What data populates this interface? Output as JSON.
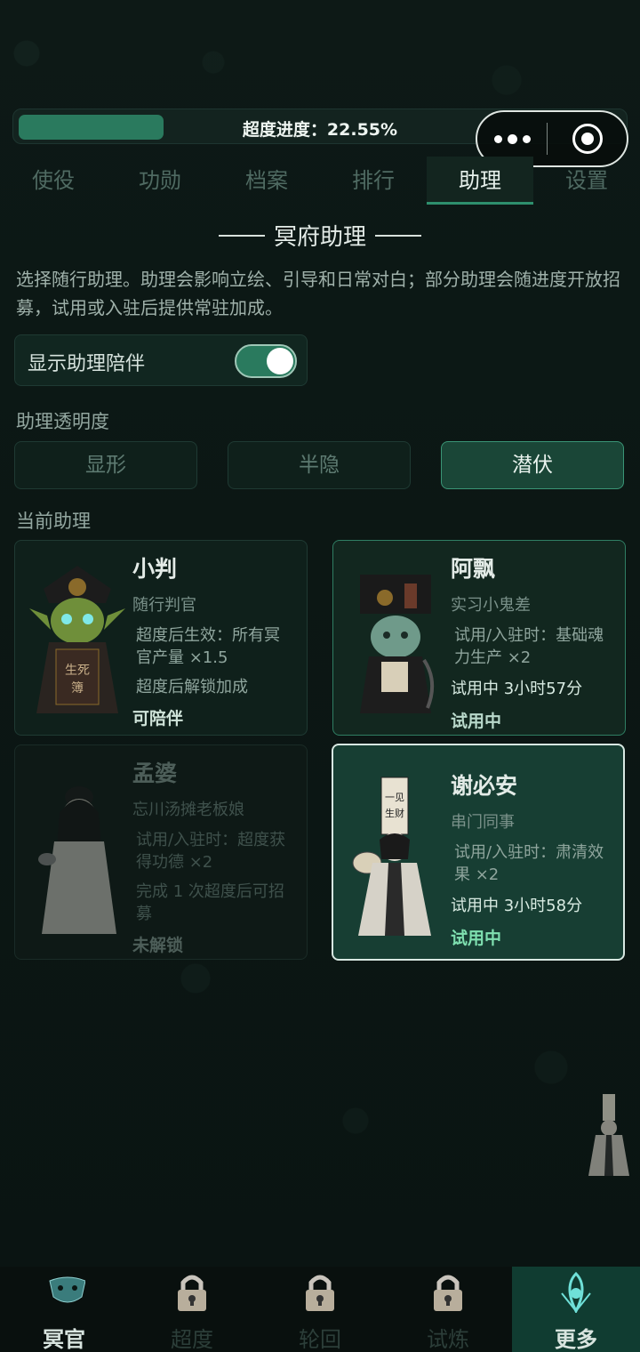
{
  "progress": {
    "label": "超度进度：22.55%",
    "fraction": 0.2255
  },
  "capsule": {
    "more_icon": "dots-icon",
    "close_icon": "target-icon"
  },
  "tabs": [
    {
      "label": "使役",
      "active": false
    },
    {
      "label": "功勋",
      "active": false
    },
    {
      "label": "档案",
      "active": false
    },
    {
      "label": "排行",
      "active": false
    },
    {
      "label": "助理",
      "active": true
    },
    {
      "label": "设置",
      "active": false
    }
  ],
  "section": {
    "title": "冥府助理",
    "description": "选择随行助理。助理会影响立绘、引导和日常对白；部分助理会随进度开放招募，试用或入驻后提供常驻加成。"
  },
  "toggle": {
    "label": "显示助理陪伴",
    "on": true
  },
  "opacity": {
    "label": "助理透明度",
    "options": [
      "显形",
      "半隐",
      "潜伏"
    ],
    "selected": "潜伏"
  },
  "current": {
    "label": "当前助理",
    "cards": [
      {
        "name": "小判",
        "role": "随行判官",
        "effect": "超度后生效：所有冥官产量 ×1.5",
        "status_line": "超度后解锁加成",
        "status": "可陪伴"
      },
      {
        "name": "阿飘",
        "role": "实习小鬼差",
        "effect": "试用/入驻时：基础魂力生产 ×2",
        "status_line": "试用中 3小时57分",
        "status": "试用中"
      },
      {
        "name": "孟婆",
        "role": "忘川汤摊老板娘",
        "effect": "试用/入驻时：超度获得功德 ×2",
        "status_line": "完成 1 次超度后可招募",
        "status": "未解锁"
      },
      {
        "name": "谢必安",
        "role": "串门同事",
        "effect": "试用/入驻时：肃清效果 ×2",
        "status_line": "试用中 3小时58分",
        "status": "试用中"
      }
    ]
  },
  "nav": [
    {
      "label": "冥官",
      "icon": "mask-icon",
      "locked": false,
      "active": false
    },
    {
      "label": "超度",
      "icon": "lock-icon",
      "locked": true,
      "active": false
    },
    {
      "label": "轮回",
      "icon": "lock-icon",
      "locked": true,
      "active": false
    },
    {
      "label": "试炼",
      "icon": "lock-icon",
      "locked": true,
      "active": false
    },
    {
      "label": "更多",
      "icon": "lotus-icon",
      "locked": false,
      "active": true
    }
  ],
  "colors": {
    "accent": "#2a7a5e",
    "background": "#0b1613",
    "active_tab": "#2e8f6d"
  }
}
